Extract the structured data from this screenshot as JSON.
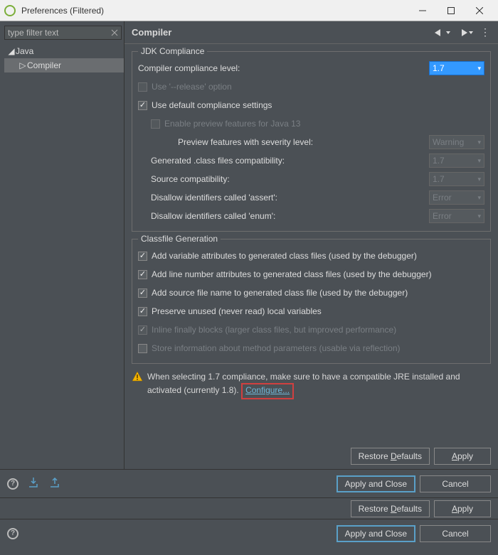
{
  "window": {
    "title": "Preferences (Filtered)"
  },
  "sidebar": {
    "filter_placeholder": "type filter text",
    "items": [
      {
        "label": "Java",
        "expanded": true
      },
      {
        "label": "Compiler",
        "selected": true
      }
    ]
  },
  "header": {
    "title": "Compiler"
  },
  "jdk": {
    "legend": "JDK Compliance",
    "compliance_label": "Compiler compliance level:",
    "compliance_value": "1.7",
    "use_release": "Use '--release' option",
    "use_default": "Use default compliance settings",
    "enable_preview": "Enable preview features for Java 13",
    "preview_severity_label": "Preview features with severity level:",
    "preview_severity_value": "Warning",
    "generated_label": "Generated .class files compatibility:",
    "generated_value": "1.7",
    "source_label": "Source compatibility:",
    "source_value": "1.7",
    "assert_label": "Disallow identifiers called 'assert':",
    "assert_value": "Error",
    "enum_label": "Disallow identifiers called 'enum':",
    "enum_value": "Error"
  },
  "classfile": {
    "legend": "Classfile Generation",
    "var_attrs": "Add variable attributes to generated class files (used by the debugger)",
    "line_attrs": "Add line number attributes to generated class files (used by the debugger)",
    "source_file": "Add source file name to generated class file (used by the debugger)",
    "preserve_unused": "Preserve unused (never read) local variables",
    "inline_finally": "Inline finally blocks (larger class files, but improved performance)",
    "store_param": "Store information about method parameters (usable via reflection)"
  },
  "warning": {
    "text_pre": "When selecting 1.7 compliance, make sure to have a compatible JRE installed and activated (currently 1.8). ",
    "link": "Configure..."
  },
  "buttons": {
    "restore": "Restore Defaults",
    "apply": "Apply",
    "apply_close": "Apply and Close",
    "cancel": "Cancel"
  }
}
